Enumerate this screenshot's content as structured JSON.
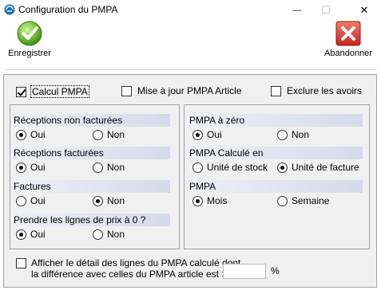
{
  "window": {
    "title": "Configuration du PMPA",
    "minimize_glyph": "—",
    "maximize_glyph": "☐",
    "close_glyph": "✕"
  },
  "toolbar": {
    "save_label": "Enregistrer",
    "save_icon": "green-checkmark-icon",
    "cancel_label": "Abandonner",
    "cancel_icon": "red-x-icon"
  },
  "top_options": {
    "calcul_pmpa": {
      "label": "Calcul PMPA",
      "checked": true
    },
    "mise_a_jour": {
      "label": "Mise à jour PMPA Article",
      "checked": false
    },
    "exclure_avoirs": {
      "label": "Exclure les avoirs",
      "checked": false
    }
  },
  "left_group": {
    "receptions_non_facturees": {
      "title": "Réceptions non facturées",
      "oui": "Oui",
      "non": "Non",
      "selected": "Oui"
    },
    "receptions_facturees": {
      "title": "Réceptions facturées",
      "oui": "Oui",
      "non": "Non",
      "selected": "Oui"
    },
    "factures": {
      "title": "Factures",
      "oui": "Oui",
      "non": "Non",
      "selected": "Non"
    },
    "lignes_prix_zero": {
      "title": "Prendre les lignes de prix à 0 ?",
      "oui": "Oui",
      "non": "Non",
      "selected": "Oui"
    }
  },
  "right_group": {
    "pmpa_zero": {
      "title": "PMPA  à zéro",
      "oui": "Oui",
      "non": "Non",
      "selected": "Oui"
    },
    "pmpa_calcule_en": {
      "title": "PMPA Calculé en",
      "opt1": "Unité de stock",
      "opt2": "Unité de facture",
      "selected": "Unité de facture"
    },
    "pmpa_periode": {
      "title": "PMPA",
      "opt1": "Mois",
      "opt2": "Semaine",
      "selected": "Mois"
    }
  },
  "bottom": {
    "line1": "Afficher le détail des lignes du PMPA calculé dont",
    "line2": "la différence avec celles du PMPA article est > à",
    "value": "",
    "unit": "%",
    "checked": false
  },
  "colors": {
    "section_header_start": "#eef0f7",
    "section_header_end": "#d5d9ea",
    "panel_bg": "#f0f0f0"
  }
}
